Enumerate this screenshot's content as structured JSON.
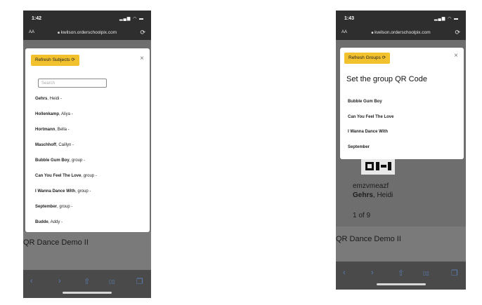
{
  "left": {
    "status_time": "1:42",
    "url": "kwilson.orderschoolpix.com",
    "aa": "AA",
    "refresh_label": "Refresh Subjects",
    "search_placeholder": "Search",
    "subjects": [
      {
        "last": "Gehrs",
        "rest": ", Heidi -"
      },
      {
        "last": "Hollenkamp",
        "rest": ", Aliya -"
      },
      {
        "last": "Hortmann",
        "rest": ", Bella -"
      },
      {
        "last": "Maschhoff",
        "rest": ", Caillyn -"
      },
      {
        "last": "Bubble Gum Boy",
        "rest": ", group -"
      },
      {
        "last": "Can You Feel The Love",
        "rest": ", group -"
      },
      {
        "last": "I Wanna Dance With",
        "rest": ", group -"
      },
      {
        "last": "September",
        "rest": ", group -"
      },
      {
        "last": "Budde",
        "rest": ", Addy -"
      }
    ],
    "page_title": "QR Dance Demo II"
  },
  "right": {
    "status_time": "1:43",
    "url": "kwilson.orderschoolpix.com",
    "aa": "AA",
    "refresh_label": "Refresh Groups",
    "heading": "Set the group QR Code",
    "groups": [
      "Bubble Gum Boy",
      "Can You Feel The Love",
      "I Wanna Dance With",
      "September"
    ],
    "code": "emzvmeazf",
    "name_last": "Gehrs",
    "name_rest": ", Heidi",
    "count": "1 of 9",
    "page_title": "QR Dance Demo II"
  },
  "icons": {
    "close": "×",
    "refresh": "⟳",
    "lock": "🔒",
    "back": "‹",
    "forward": "›",
    "share": "⇧",
    "bookmarks": "▯▯",
    "tabs": "❐"
  }
}
